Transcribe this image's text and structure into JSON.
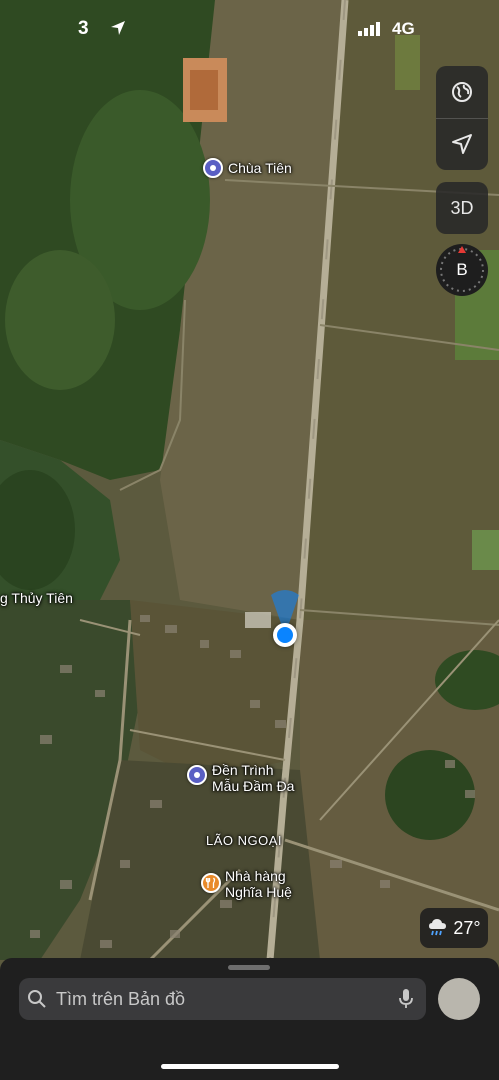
{
  "status_bar": {
    "time": "3",
    "network": "4G"
  },
  "map_controls": {
    "view_3d": "3D",
    "compass_heading": "B"
  },
  "places": [
    {
      "name": "Chùa Tiên"
    },
    {
      "name": "g Thủy Tiên"
    },
    {
      "name_line1": "Đền Trình",
      "name_line2": "Mẫu Đầm Đa"
    },
    {
      "name": "LÃO NGOẠI"
    },
    {
      "name_line1": "Nhà hàng",
      "name_line2": "Nghĩa Huệ"
    }
  ],
  "weather": {
    "temperature": "27°"
  },
  "search": {
    "placeholder": "Tìm trên Bản đồ"
  },
  "colors": {
    "location_blue": "#0a84ff",
    "poi_purple": "#5a5fc4",
    "poi_food": "#e88a2a"
  }
}
